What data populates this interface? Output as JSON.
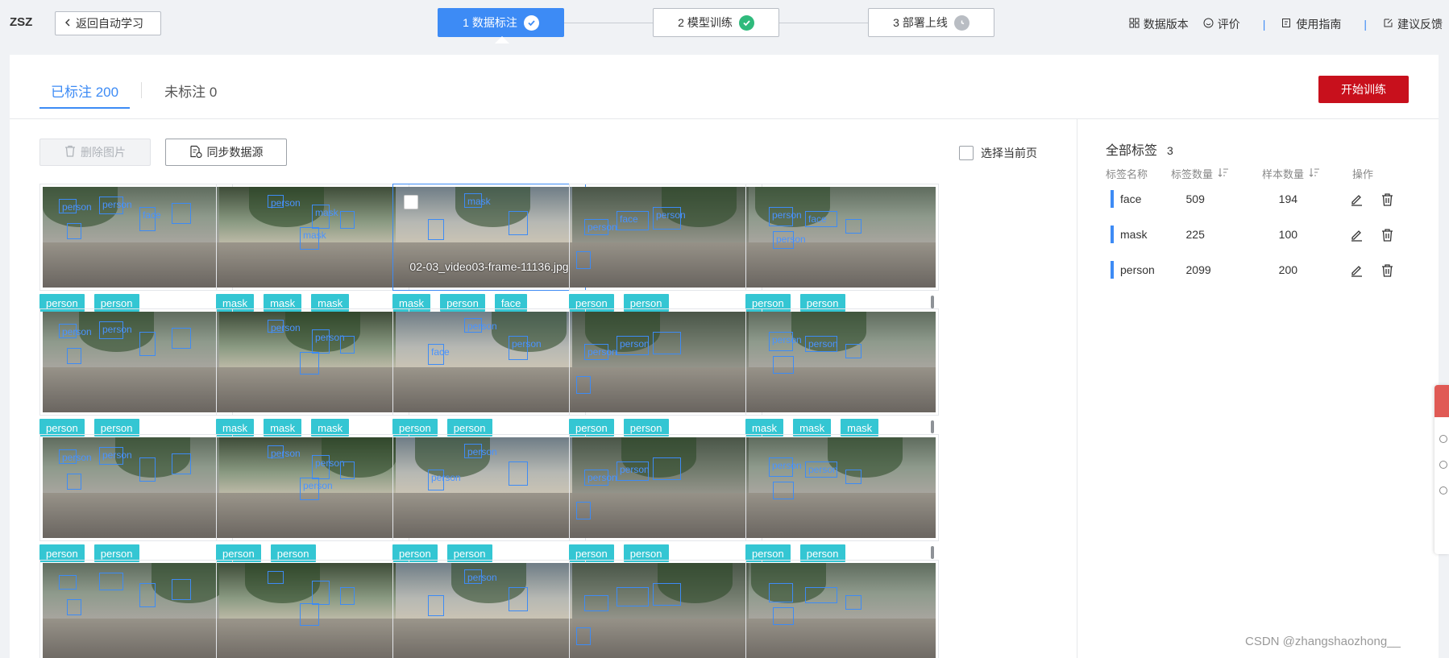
{
  "header": {
    "brand": "ZSZ",
    "back_label": "返回自动学习",
    "steps": [
      {
        "label": "1 数据标注",
        "status": "active"
      },
      {
        "label": "2 模型训练",
        "status": "done"
      },
      {
        "label": "3 部署上线",
        "status": "pending"
      }
    ],
    "actions": {
      "data_version": "数据版本",
      "rate": "评价",
      "guide": "使用指南",
      "feedback": "建议反馈"
    }
  },
  "tabs": [
    {
      "label": "已标注 200",
      "active": true
    },
    {
      "label": "未标注 0",
      "active": false
    }
  ],
  "start_training": "开始训练",
  "toolbar": {
    "delete_label": "删除图片",
    "sync_label": "同步数据源",
    "select_page_label": "选择当前页"
  },
  "images": [
    {
      "tags": [
        "person",
        "person"
      ],
      "boxlabels": [
        "person",
        "person",
        "face"
      ]
    },
    {
      "tags": [
        "mask",
        "mask",
        "mask"
      ],
      "boxlabels": [
        "person",
        "mask",
        "mask"
      ]
    },
    {
      "tags": [
        "mask",
        "person",
        "face"
      ],
      "filename": "02-03_video03-frame-11136.jpg",
      "selected": true,
      "boxlabels": [
        "mask"
      ]
    },
    {
      "tags": [
        "person",
        "person"
      ],
      "boxlabels": [
        "person",
        "face",
        "person"
      ]
    },
    {
      "tags": [
        "person",
        "person"
      ],
      "boxlabels": [
        "person",
        "face",
        "person"
      ]
    },
    {
      "tags": [
        "person",
        "person"
      ],
      "boxlabels": [
        "person",
        "person"
      ]
    },
    {
      "tags": [
        "mask",
        "mask",
        "mask"
      ],
      "boxlabels": [
        "person",
        "person"
      ]
    },
    {
      "tags": [
        "person",
        "person"
      ],
      "boxlabels": [
        "person",
        "face",
        "person"
      ]
    },
    {
      "tags": [
        "person",
        "person"
      ],
      "boxlabels": [
        "person",
        "person"
      ]
    },
    {
      "tags": [
        "mask",
        "mask",
        "mask"
      ],
      "boxlabels": [
        "person",
        "person"
      ]
    },
    {
      "tags": [
        "person",
        "person"
      ],
      "boxlabels": [
        "person",
        "person"
      ]
    },
    {
      "tags": [
        "person",
        "person"
      ],
      "boxlabels": [
        "person",
        "person",
        "person"
      ]
    },
    {
      "tags": [
        "person",
        "person"
      ],
      "boxlabels": [
        "person",
        "person"
      ]
    },
    {
      "tags": [
        "person",
        "person"
      ],
      "boxlabels": [
        "person",
        "person"
      ]
    },
    {
      "tags": [
        "person",
        "person"
      ],
      "boxlabels": [
        "person",
        "person"
      ]
    },
    {
      "tags": [],
      "boxlabels": []
    },
    {
      "tags": [],
      "boxlabels": []
    },
    {
      "tags": [],
      "boxlabels": [
        "person"
      ]
    },
    {
      "tags": [],
      "boxlabels": []
    },
    {
      "tags": [],
      "boxlabels": []
    }
  ],
  "labels_panel": {
    "title": "全部标签",
    "count": "3",
    "columns": [
      "标签名称",
      "标签数量",
      "样本数量",
      "操作"
    ],
    "rows": [
      {
        "name": "face",
        "label_count": "509",
        "sample_count": "194"
      },
      {
        "name": "mask",
        "label_count": "225",
        "sample_count": "100"
      },
      {
        "name": "person",
        "label_count": "2099",
        "sample_count": "200"
      }
    ]
  },
  "watermark": "CSDN @zhangshaozhong__",
  "colors": {
    "primary": "#3d8bf5",
    "danger": "#c8101c",
    "tag": "#34c6d3",
    "done": "#2fba7c",
    "box": "#3d8bf5"
  }
}
